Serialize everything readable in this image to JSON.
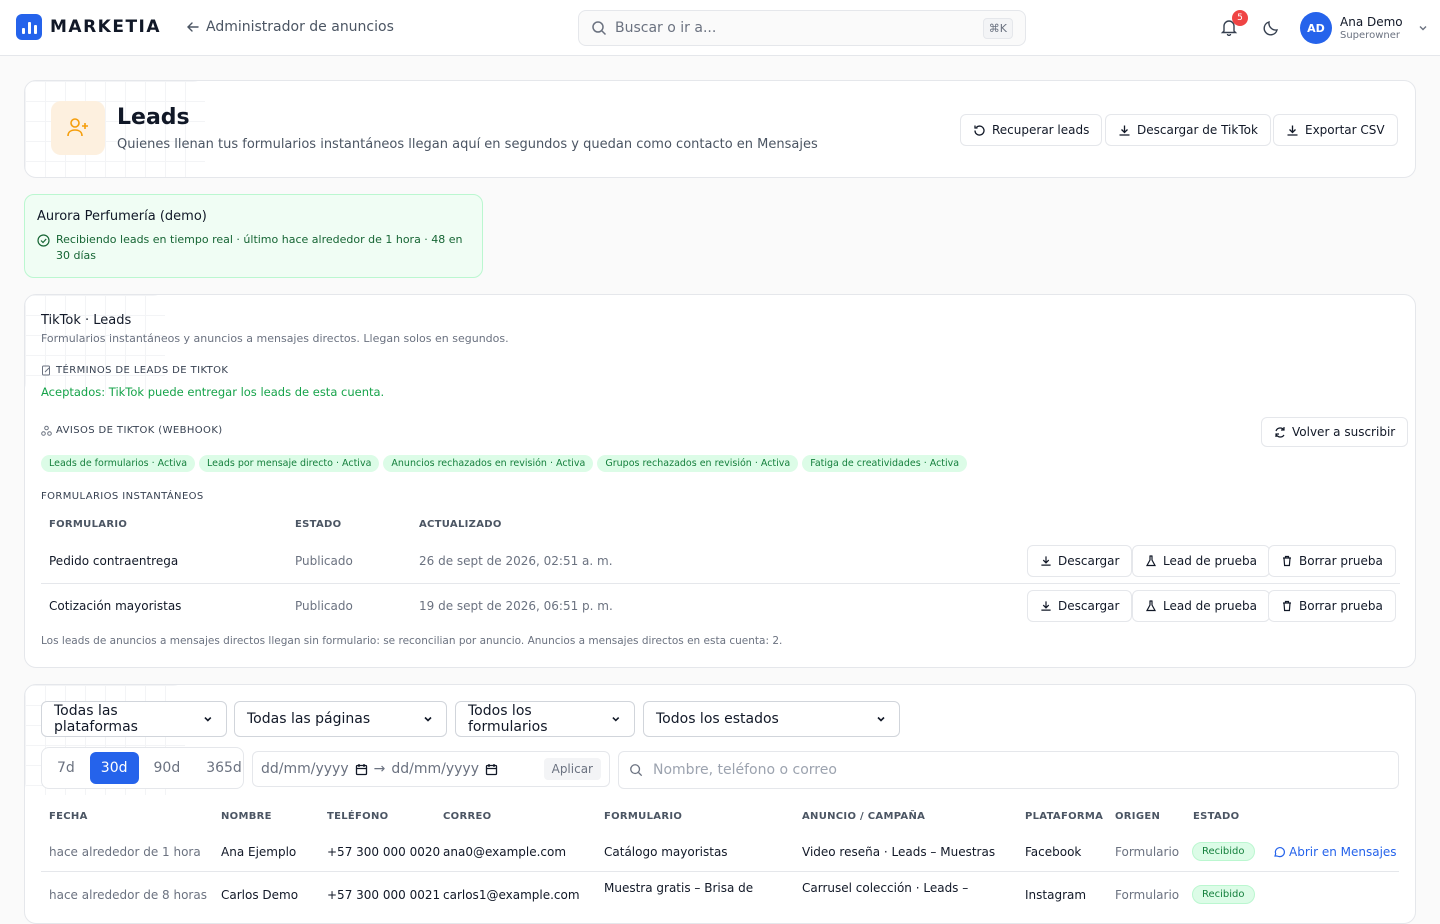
{
  "header": {
    "brand": "MARKETIA",
    "back_label": "Administrador de anuncios",
    "search_placeholder": "Buscar o ir a...",
    "search_shortcut": "⌘K",
    "notifications_count": "5",
    "user": {
      "initials": "AD",
      "name": "Ana Demo",
      "role": "Superowner"
    }
  },
  "page": {
    "title": "Leads",
    "subtitle": "Quienes llenan tus formularios instantáneos llegan aquí en segundos y quedan como contacto en Mensajes",
    "actions": {
      "recover": "Recuperar leads",
      "download_tiktok": "Descargar de TikTok",
      "export_csv": "Exportar CSV"
    }
  },
  "account": {
    "name": "Aurora Perfumería (demo)",
    "status": "Recibiendo leads en tiempo real · último hace alrededor de 1 hora · 48 en 30 días"
  },
  "tiktok": {
    "title": "TikTok · Leads",
    "description": "Formularios instantáneos y anuncios a mensajes directos. Llegan solos en segundos.",
    "terms_label": "TÉRMINOS DE LEADS DE TIKTOK",
    "terms_status": "Aceptados: TikTok puede entregar los leads de esta cuenta.",
    "webhook_label": "AVISOS DE TIKTOK (WEBHOOK)",
    "resubscribe": "Volver a suscribir",
    "webhooks": [
      "Leads de formularios · Activa",
      "Leads por mensaje directo · Activa",
      "Anuncios rechazados en revisión · Activa",
      "Grupos rechazados en revisión · Activa",
      "Fatiga de creatividades · Activa"
    ],
    "forms_label": "FORMULARIOS INSTANTÁNEOS",
    "forms_columns": [
      "FORMULARIO",
      "ESTADO",
      "ACTUALIZADO"
    ],
    "forms": [
      {
        "name": "Pedido contraentrega",
        "status": "Publicado",
        "updated": "26 de sept de 2026, 02:51 a. m."
      },
      {
        "name": "Cotización mayoristas",
        "status": "Publicado",
        "updated": "19 de sept de 2026, 06:51 p. m."
      }
    ],
    "row_actions": {
      "download": "Descargar",
      "test_lead": "Lead de prueba",
      "delete_test": "Borrar prueba"
    },
    "footnote": "Los leads de anuncios a mensajes directos llegan sin formulario: se reconcilian por anuncio. Anuncios a mensajes directos en esta cuenta: 2."
  },
  "filters": {
    "platform": "Todas las plataformas",
    "pages": "Todas las páginas",
    "forms": "Todos los formularios",
    "states": "Todos los estados",
    "ranges": [
      "7d",
      "30d",
      "90d",
      "365d"
    ],
    "active_range": "30d",
    "date_from": "dd/mm/yyyy",
    "date_to": "dd/mm/yyyy",
    "date_sep": "→",
    "apply": "Aplicar",
    "search_placeholder": "Nombre, teléfono o correo"
  },
  "leads": {
    "columns": [
      "FECHA",
      "NOMBRE",
      "TELÉFONO",
      "CORREO",
      "FORMULARIO",
      "ANUNCIO / CAMPAÑA",
      "PLATAFORMA",
      "ORIGEN",
      "ESTADO"
    ],
    "open_label": "Abrir en Mensajes",
    "rows": [
      {
        "date": "hace alrededor de 1 hora",
        "name": "Ana Ejemplo",
        "phone": "+57 300 000 0020",
        "email": "ana0@example.com",
        "form": "Catálogo mayoristas",
        "ad": "Video reseña · Leads – Muestras",
        "platform": "Facebook",
        "origin": "Formulario",
        "status": "Recibido"
      },
      {
        "date": "hace alrededor de 8 horas",
        "name": "Carlos Demo",
        "phone": "+57 300 000 0021",
        "email": "carlos1@example.com",
        "form": "Muestra gratis – Brisa de",
        "ad": "Carrusel colección · Leads –",
        "platform": "Instagram",
        "origin": "Formulario",
        "status": "Recibido"
      }
    ]
  }
}
